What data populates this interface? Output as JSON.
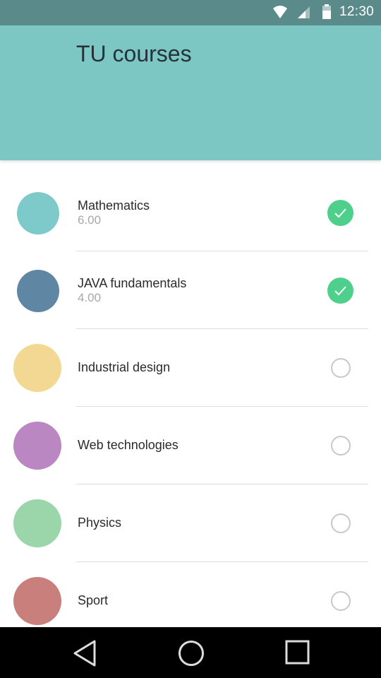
{
  "status_bar": {
    "time": "12:30",
    "icons": [
      "wifi-icon",
      "cell-signal-icon",
      "battery-icon"
    ]
  },
  "header": {
    "title": "TU courses",
    "background": "#7cc6c4"
  },
  "courses": [
    {
      "name": "Mathematics",
      "credits": "6.00",
      "color": "#7ecaca",
      "completed": true
    },
    {
      "name": "JAVA fundamentals",
      "credits": "4.00",
      "color": "#5f87a3",
      "completed": true
    },
    {
      "name": "Industrial design",
      "color": "#f3d893",
      "completed": false
    },
    {
      "name": "Web technologies",
      "color": "#bb87c3",
      "completed": false
    },
    {
      "name": "Physics",
      "color": "#9bd5aa",
      "completed": false
    },
    {
      "name": "Sport",
      "color": "#c9807c",
      "completed": false
    }
  ],
  "colors": {
    "status_bar": "#5a8b8a",
    "check_done": "#4fcf8c",
    "check_empty_border": "#c8c8c8",
    "nav_bar": "#000000"
  },
  "nav_bar": {
    "buttons": [
      "back-icon",
      "home-icon",
      "recents-icon"
    ]
  }
}
